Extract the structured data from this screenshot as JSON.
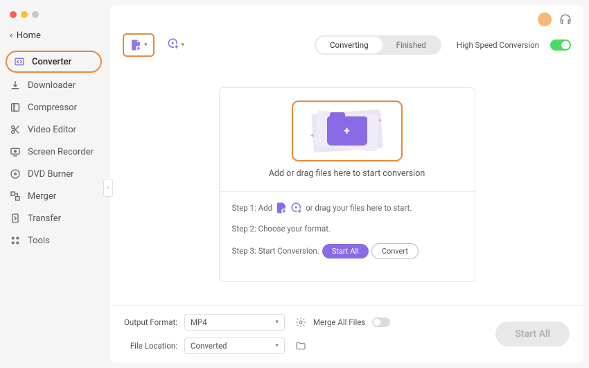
{
  "home_label": "Home",
  "sidebar": {
    "items": [
      {
        "label": "Converter",
        "icon": "converter"
      },
      {
        "label": "Downloader",
        "icon": "downloader"
      },
      {
        "label": "Compressor",
        "icon": "compressor"
      },
      {
        "label": "Video Editor",
        "icon": "editor"
      },
      {
        "label": "Screen Recorder",
        "icon": "recorder"
      },
      {
        "label": "DVD Burner",
        "icon": "dvd"
      },
      {
        "label": "Merger",
        "icon": "merger"
      },
      {
        "label": "Transfer",
        "icon": "transfer"
      },
      {
        "label": "Tools",
        "icon": "tools"
      }
    ]
  },
  "tabs": {
    "converting": "Converting",
    "finished": "Finished"
  },
  "high_speed_label": "High Speed Conversion",
  "dropzone": {
    "text": "Add or drag files here to start conversion",
    "step1_prefix": "Step 1: Add",
    "step1_suffix": "or drag your files here to start.",
    "step2": "Step 2: Choose your format.",
    "step3_prefix": "Step 3: Start Conversion.",
    "start_all": "Start  All",
    "convert": "Convert"
  },
  "footer": {
    "output_format_label": "Output Format:",
    "output_format_value": "MP4",
    "file_location_label": "File Location:",
    "file_location_value": "Converted",
    "merge_label": "Merge All Files",
    "start_all_btn": "Start All"
  }
}
